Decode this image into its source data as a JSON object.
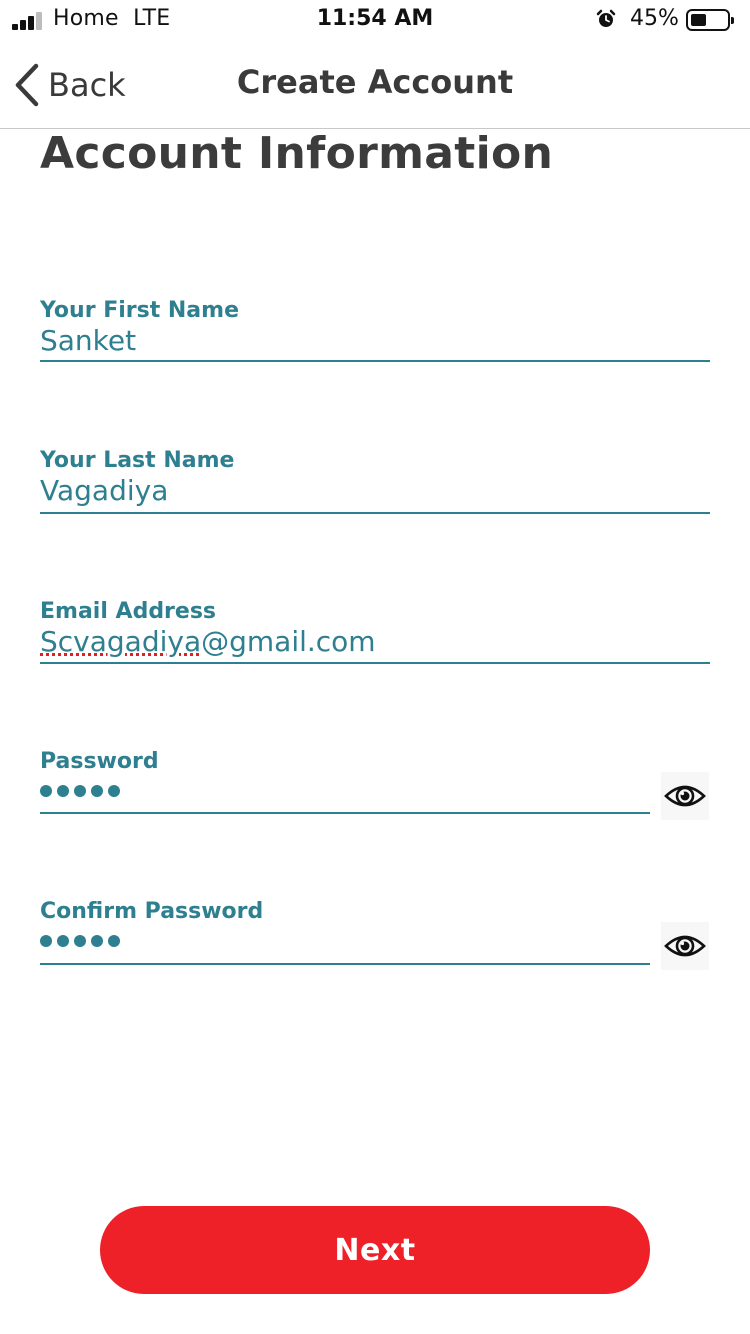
{
  "status_bar": {
    "carrier": "Home",
    "network": "LTE",
    "time": "11:54 AM",
    "battery_percent": "45%",
    "battery_level": 0.45,
    "alarm_icon": "alarm-clock-icon",
    "signal_bars": 3
  },
  "nav": {
    "back_label": "Back",
    "title": "Create Account"
  },
  "section_title": "Account Information",
  "form": {
    "first_name": {
      "label": "Your First Name",
      "value": "Sanket"
    },
    "last_name": {
      "label": "Your Last Name",
      "value": "Vagadiya"
    },
    "email": {
      "label": "Email Address",
      "value_misspelled": "Scvagadiya",
      "value_rest": "@gmail.com"
    },
    "password": {
      "label": "Password",
      "masked_length": 5,
      "toggle_icon": "eye-icon"
    },
    "confirm_password": {
      "label": "Confirm Password",
      "masked_length": 5,
      "toggle_icon": "eye-icon"
    }
  },
  "next_label": "Next",
  "colors": {
    "accent_teal": "#2e7f8f",
    "button_red": "#ee2129",
    "title_gray": "#3c3c3c"
  }
}
